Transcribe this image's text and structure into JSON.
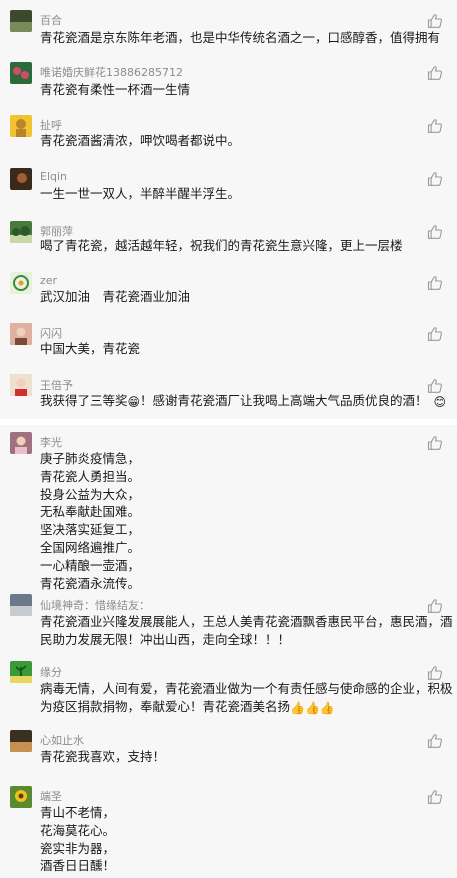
{
  "comments": [
    {
      "name": "百合",
      "lines": [
        "青花瓷酒是京东陈年老酒，也是中华传统名酒之一，口感醇香，值得拥有"
      ],
      "avatar": "avatar-landscape",
      "colors": [
        "#3a4a2a",
        "#7a8a5a"
      ]
    },
    {
      "name": "唯诺婚庆鲜花13886285712",
      "lines": [
        "青花瓷有柔性一杯酒一生情"
      ],
      "avatar": "avatar-flowers",
      "colors": [
        "#2c6a3a",
        "#d04a6a"
      ]
    },
    {
      "name": "扯呼",
      "lines": [
        "青花瓷酒酱清浓，呷饮喝者都说中。"
      ],
      "avatar": "avatar-buddha",
      "colors": [
        "#f2c230",
        "#b8862a"
      ]
    },
    {
      "name": "Elqin   ",
      "lines": [
        "一生一世一双人，半醉半醒半浮生。"
      ],
      "avatar": "avatar-dark",
      "colors": [
        "#3a2a1a",
        "#a06030"
      ]
    },
    {
      "name": "郭丽萍",
      "lines": [
        "喝了青花瓷，越活越年轻，祝我们的青花瓷生意兴隆，更上一层楼"
      ],
      "avatar": "avatar-trees",
      "colors": [
        "#4a7a3a",
        "#c8d8a8"
      ]
    },
    {
      "name": "zer",
      "lines": [
        "武汉加油　青花瓷酒业加油"
      ],
      "avatar": "avatar-logo",
      "colors": [
        "#e8f0e0",
        "#3a8a3a"
      ]
    },
    {
      "name": "闪闪",
      "lines": [
        "中国大美，青花瓷"
      ],
      "avatar": "avatar-girl",
      "colors": [
        "#7a4a3a",
        "#e0b0a0"
      ]
    },
    {
      "name": "王倍予",
      "lines": [
        "我获得了三等奖",
        "！感谢青花瓷酒厂让我喝上高端大气品质优良的酒！"
      ],
      "emojis": [
        "😁",
        "😊"
      ],
      "avatar": "avatar-child",
      "colors": [
        "#d03030",
        "#f0e0d0"
      ]
    },
    {
      "name": "李光",
      "lines": [
        "庚子肺炎疫情急，",
        "青花瓷人勇担当。",
        "投身公益为大众，",
        "无私奉献赴国难。",
        "坚决落实延复工，",
        "全国网络遍推广。",
        "一心精酿一壶酒，",
        "青花瓷酒永流传。"
      ],
      "avatar": "avatar-pink",
      "colors": [
        "#e8c0c8",
        "#a07080"
      ]
    },
    {
      "name": "仙境神奇：惜缘结友：",
      "lines": [
        "青花瓷酒业兴隆发展展能人，王总人美青花瓷酒飘香惠民平台，惠民酒，酒",
        "民助力发展无限！冲出山西，走向全球！！！"
      ],
      "avatar": "avatar-horizon",
      "colors": [
        "#6a7a8a",
        "#c8ccd0"
      ]
    },
    {
      "name": "缘分",
      "lines": [
        "病毒无情，人间有爱，青花瓷酒业做为一个有责任感与使命感的企业，积极",
        "为疫区捐款捐物，奉献爱心！青花瓷酒美名扬"
      ],
      "emojis": [
        "👍👍👍"
      ],
      "avatar": "avatar-plant",
      "colors": [
        "#3a9a3a",
        "#e8d860"
      ]
    },
    {
      "name": "心如止水",
      "lines": [
        "青花瓷我喜欢，支持！"
      ],
      "avatar": "avatar-lake",
      "colors": [
        "#3a3020",
        "#c89050"
      ]
    },
    {
      "name": "端圣",
      "lines": [
        "青山不老情，",
        "花海莫花心。",
        "瓷实非为器，",
        "酒香日日醺！"
      ],
      "avatar": "avatar-sunflower",
      "colors": [
        "#f0c020",
        "#5a8a30"
      ]
    }
  ],
  "icons": {
    "like": "thumbs-up-icon"
  },
  "colors": {
    "background": "#f7f7f7",
    "name": "#8c8c8c",
    "text": "#191919",
    "like": "#9a9a9a"
  }
}
